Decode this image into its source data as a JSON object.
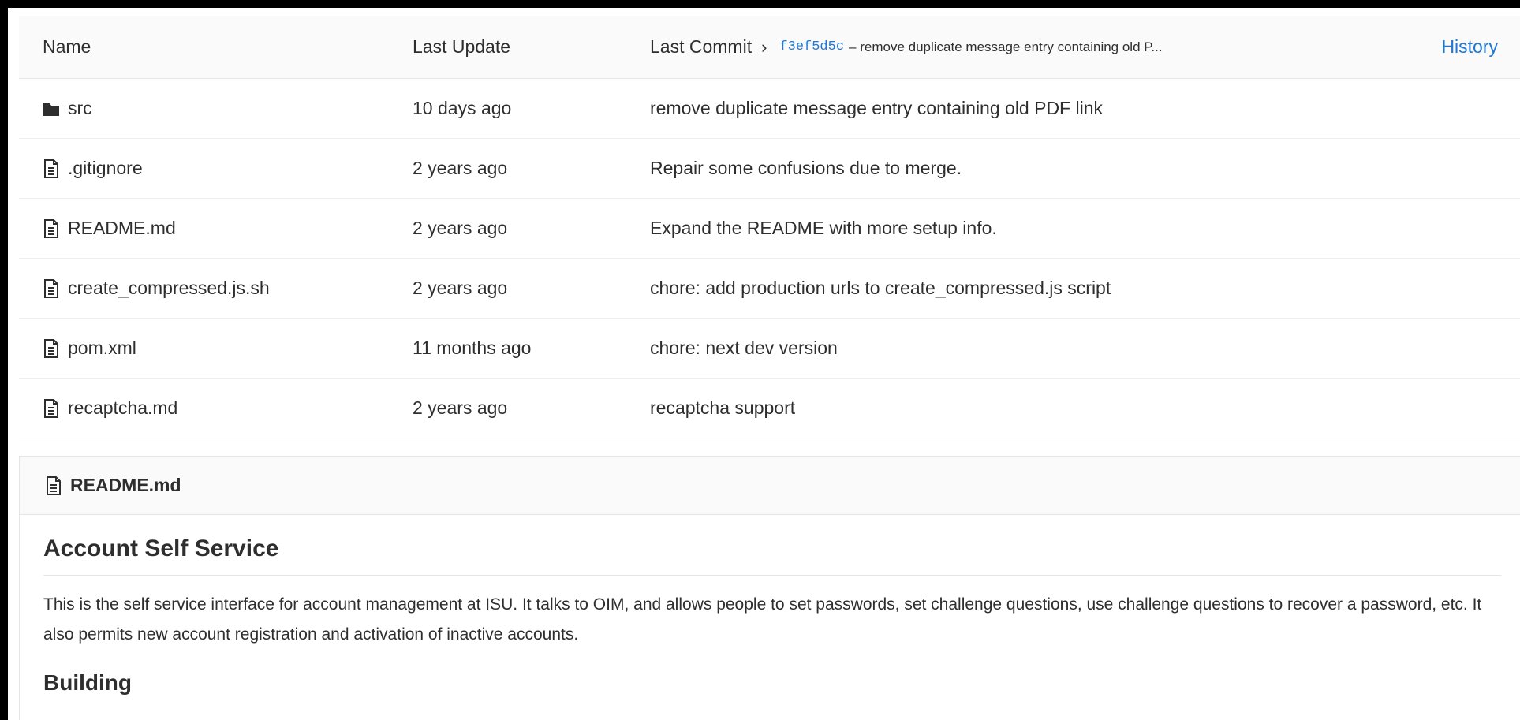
{
  "tree_header": {
    "name_label": "Name",
    "last_update_label": "Last Update",
    "last_commit_label": "Last Commit",
    "commit_sha": "f3ef5d5c",
    "commit_message": "– remove duplicate message entry containing old P...",
    "history_label": "History"
  },
  "files": [
    {
      "icon": "folder-icon",
      "name": "src",
      "updated": "10 days ago",
      "commit": "remove duplicate message entry containing old PDF link"
    },
    {
      "icon": "file-text-icon",
      "name": ".gitignore",
      "updated": "2 years ago",
      "commit": "Repair some confusions due to merge."
    },
    {
      "icon": "file-text-icon",
      "name": "README.md",
      "updated": "2 years ago",
      "commit": "Expand the README with more setup info."
    },
    {
      "icon": "file-text-icon",
      "name": "create_compressed.js.sh",
      "updated": "2 years ago",
      "commit": "chore: add production urls to create_compressed.js script"
    },
    {
      "icon": "file-text-icon",
      "name": "pom.xml",
      "updated": "11 months ago",
      "commit": "chore: next dev version"
    },
    {
      "icon": "file-text-icon",
      "name": "recaptcha.md",
      "updated": "2 years ago",
      "commit": "recaptcha support"
    }
  ],
  "readme": {
    "filename": "README.md",
    "h1": "Account Self Service",
    "paragraph": "This is the self service interface for account management at ISU. It talks to OIM, and allows people to set passwords, set challenge questions, use challenge questions to recover a password, etc. It also permits new account registration and activation of inactive accounts.",
    "h2": "Building"
  },
  "colors": {
    "link": "#1f78d1",
    "text": "#2e2e2e",
    "header_bg": "#fafafa",
    "border": "#e5e5e5"
  }
}
